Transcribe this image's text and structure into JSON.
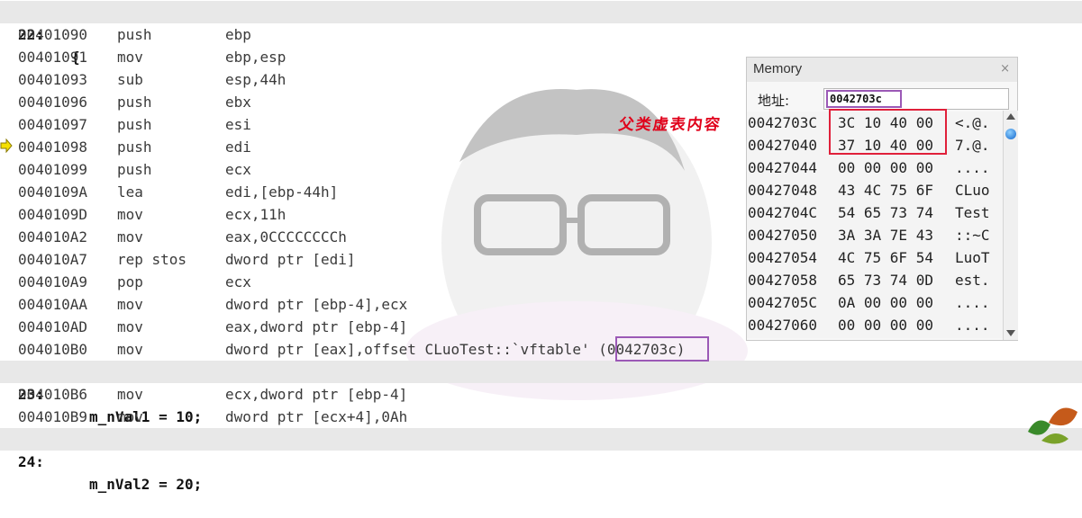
{
  "source_lines": {
    "l22": {
      "num": "22:",
      "stmt": "{"
    },
    "l23": {
      "num": "23:",
      "stmt": "m_nVal1 = 10;"
    },
    "l24": {
      "num": "24:",
      "stmt": "m_nVal2 = 20;"
    }
  },
  "asm": [
    {
      "addr": "00401090",
      "mnem": "push",
      "ops": "ebp"
    },
    {
      "addr": "00401091",
      "mnem": "mov",
      "ops": "ebp,esp"
    },
    {
      "addr": "00401093",
      "mnem": "sub",
      "ops": "esp,44h"
    },
    {
      "addr": "00401096",
      "mnem": "push",
      "ops": "ebx"
    },
    {
      "addr": "00401097",
      "mnem": "push",
      "ops": "esi"
    },
    {
      "addr": "00401098",
      "mnem": "push",
      "ops": "edi"
    },
    {
      "addr": "00401099",
      "mnem": "push",
      "ops": "ecx"
    },
    {
      "addr": "0040109A",
      "mnem": "lea",
      "ops": "edi,[ebp-44h]"
    },
    {
      "addr": "0040109D",
      "mnem": "mov",
      "ops": "ecx,11h"
    },
    {
      "addr": "004010A2",
      "mnem": "mov",
      "ops": "eax,0CCCCCCCCh"
    },
    {
      "addr": "004010A7",
      "mnem": "rep stos",
      "ops": "dword ptr [edi]"
    },
    {
      "addr": "004010A9",
      "mnem": "pop",
      "ops": "ecx"
    },
    {
      "addr": "004010AA",
      "mnem": "mov",
      "ops": "dword ptr [ebp-4],ecx"
    },
    {
      "addr": "004010AD",
      "mnem": "mov",
      "ops": "eax,dword ptr [ebp-4]"
    },
    {
      "addr": "004010B0",
      "mnem": "mov",
      "ops": "dword ptr [eax],offset CLuoTest::`vftable' (0042703c)"
    },
    {
      "addr": "004010B6",
      "mnem": "mov",
      "ops": "ecx,dword ptr [ebp-4]"
    },
    {
      "addr": "004010B9",
      "mnem": "mov",
      "ops": "dword ptr [ecx+4],0Ah"
    }
  ],
  "annotation": "父类虚表内容",
  "memory": {
    "title": "Memory",
    "close": "×",
    "address_label": "地址:",
    "address_value": "0042703c",
    "rows": [
      {
        "addr": "0042703C",
        "hex": "3C 10 40 00",
        "text": "<.@."
      },
      {
        "addr": "00427040",
        "hex": "37 10 40 00",
        "text": "7.@."
      },
      {
        "addr": "00427044",
        "hex": "00 00 00 00",
        "text": "...."
      },
      {
        "addr": "00427048",
        "hex": "43 4C 75 6F",
        "text": "CLuo"
      },
      {
        "addr": "0042704C",
        "hex": "54 65 73 74",
        "text": "Test"
      },
      {
        "addr": "00427050",
        "hex": "3A 3A 7E 43",
        "text": "::~C"
      },
      {
        "addr": "00427054",
        "hex": "4C 75 6F 54",
        "text": "LuoT"
      },
      {
        "addr": "00427058",
        "hex": "65 73 74 0D",
        "text": "est."
      },
      {
        "addr": "0042705C",
        "hex": "0A 00 00 00",
        "text": "...."
      },
      {
        "addr": "00427060",
        "hex": "00 00 00 00",
        "text": "...."
      }
    ]
  },
  "colors": {
    "highlight_red": "#e0203a",
    "highlight_purple": "#9b59b6",
    "source_line_bg": "#e8e8e8",
    "arrow": "#f5e000"
  }
}
